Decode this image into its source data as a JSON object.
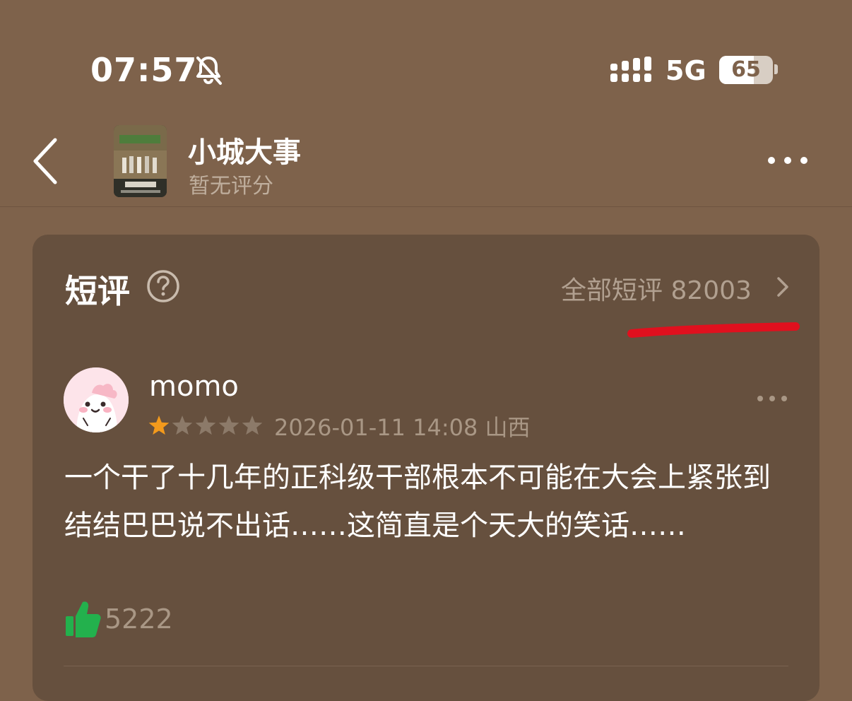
{
  "status_bar": {
    "time": "07:57",
    "network": "5G",
    "battery_percent": "65",
    "battery_level": 0.65
  },
  "header": {
    "title": "小城大事",
    "subtitle": "暂无评分",
    "back_icon": "chevron-left-icon",
    "more_icon": "more-horizontal-icon"
  },
  "section": {
    "title": "短评",
    "help_icon": "question-circle-icon",
    "all_link": "全部短评 82003"
  },
  "comment": {
    "username": "momo",
    "rating": 1,
    "rating_max": 5,
    "datetime": "2026-01-11 14:08",
    "location": "山西",
    "text": "一个干了十几年的正科级干部根本不可能在大会上紧张到结结巴巴说不出话……这简直是个天大的笑话……",
    "likes": "5222"
  },
  "colors": {
    "background": "#7e624b",
    "card": "#66503e",
    "star_active": "#f39a1c",
    "star_inactive": "#8c7a69",
    "like_green": "#23b14d",
    "annotation_red": "#e0101e"
  }
}
